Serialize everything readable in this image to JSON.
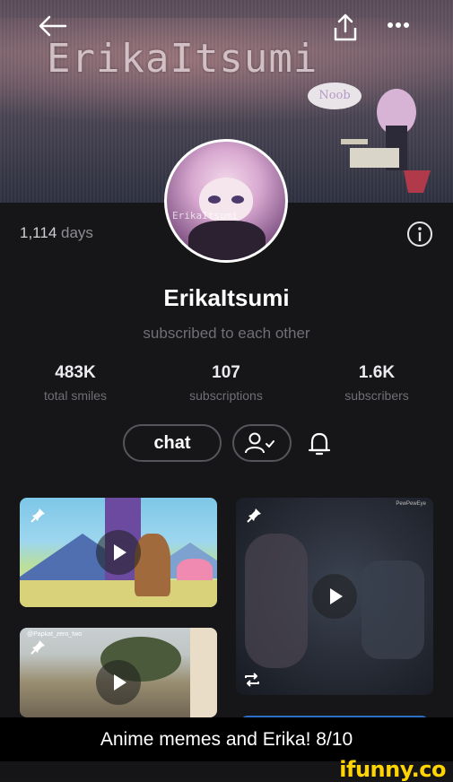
{
  "header": {
    "banner_title": "ErikaItsumi",
    "banner_badge": "Noob"
  },
  "profile": {
    "days_count": "1,114",
    "days_label": "days",
    "username": "ErikaItsumi",
    "status": "subscribed to each other",
    "avatar_watermark": "ErikaItsumi"
  },
  "stats": [
    {
      "value": "483K",
      "label": "total smiles"
    },
    {
      "value": "107",
      "label": "subscriptions"
    },
    {
      "value": "1.6K",
      "label": "subscribers"
    }
  ],
  "actions": {
    "chat_label": "chat"
  },
  "tiles": {
    "tile2_tag": "PewPewEye",
    "tile3_tag": "@Papkat_zero_two"
  },
  "caption": "Anime memes and Erika! 8/10",
  "brand": "ifunny.co"
}
